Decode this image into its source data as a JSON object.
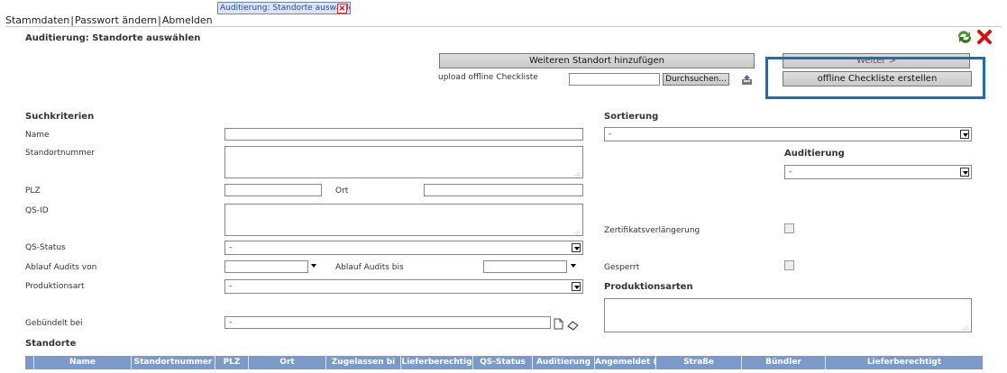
{
  "nav": {
    "stammdaten": "Stammdaten",
    "passwort": "Passwort ändern",
    "abmelden": "Abmelden",
    "sep": "|"
  },
  "tab": {
    "label": "Auditierung: Standorte auswähle"
  },
  "page": {
    "title": "Auditierung: Standorte auswählen"
  },
  "toolbar": {
    "add_location": "Weiteren Standort hinzufügen",
    "next": "Weiter >",
    "upload_label": "upload offline Checkliste",
    "browse": "Durchsuchen...",
    "create_offline": "offline Checkliste erstellen"
  },
  "search": {
    "heading": "Suchkriterien",
    "name": "Name",
    "standortnummer": "Standortnummer",
    "plz": "PLZ",
    "ort": "Ort",
    "qsid": "QS-ID",
    "qsstatus": "QS-Status",
    "qsstatus_value": "-",
    "ablauf_von": "Ablauf Audits von",
    "ablauf_bis": "Ablauf Audits bis",
    "produktionsart": "Produktionsart",
    "produktionsart_value": "-",
    "gebuendelt": "Gebündelt bei",
    "gebuendelt_value": "-"
  },
  "right": {
    "sortierung": "Sortierung",
    "sortierung_value": "-",
    "auditierung": "Auditierung",
    "auditierung_value": "-",
    "zertifikat": "Zertifikatsverlängerung",
    "gesperrt": "Gesperrt",
    "produktionsarten": "Produktionsarten"
  },
  "standorte": {
    "heading": "Standorte",
    "columns": [
      "Name",
      "Standortnummer",
      "PLZ",
      "Ort",
      "Zugelassen bi",
      "Lieferberechtig",
      "QS-Status",
      "Auditierung",
      "Angemeldet (",
      "Straße",
      "Bündler",
      "Lieferberechtigt"
    ]
  },
  "colors": {
    "header_blue": "#7c9ac9",
    "highlight": "#1a6fb4"
  }
}
